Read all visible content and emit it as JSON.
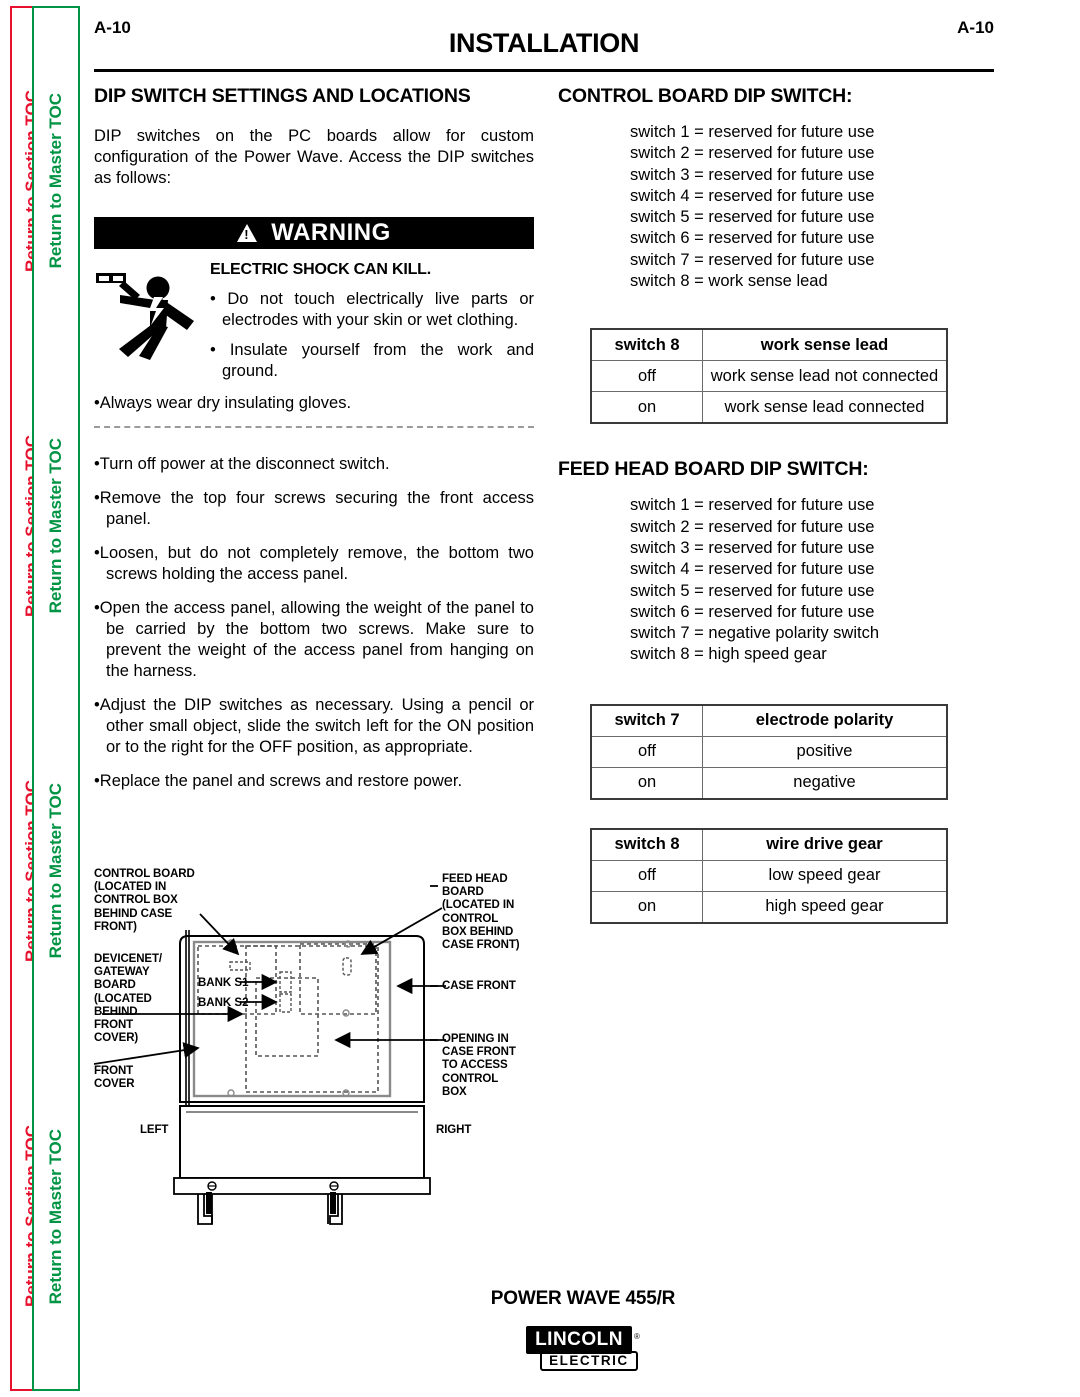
{
  "sidebar": {
    "section_toc_label": "Return to Section TOC",
    "master_toc_label": "Return to Master TOC",
    "section_color": "#e8112d",
    "master_color": "#009444",
    "repeat_count": 4
  },
  "header": {
    "page_number_left": "A-10",
    "page_number_right": "A-10",
    "title": "INSTALLATION"
  },
  "left_column": {
    "heading": "DIP SWITCH SETTINGS AND LOCATIONS",
    "intro": "DIP switches on the PC boards allow for custom configuration of the Power Wave.  Access the DIP switches as follows:",
    "warning": {
      "banner_label": "WARNING",
      "icon": "warning-triangle-icon",
      "pictogram": "electric-shock-figure-icon",
      "heading": "ELECTRIC SHOCK CAN KILL.",
      "bullets": [
        "Do not touch electrically live parts or electrodes with your skin or wet clothing.",
        "Insulate yourself from the work and ground."
      ],
      "full_width_bullet": "Always wear dry insulating gloves."
    },
    "steps": [
      "Turn off power at the disconnect switch.",
      "Remove the top four screws securing the front access panel.",
      "Loosen, but do not completely remove, the bottom two screws holding the access panel.",
      "Open the access panel, allowing the weight of the panel to be carried by the bottom two screws.  Make sure to prevent the weight of the access  panel from hanging on the harness.",
      "Adjust the DIP switches as necessary.  Using a pencil or other small object, slide the switch left for the ON position or to the right for the OFF position, as appropriate.",
      "Replace the panel and screws and restore power."
    ]
  },
  "right_column": {
    "control_board": {
      "heading": "CONTROL BOARD DIP SWITCH:",
      "switches": [
        "switch 1 = reserved for future use",
        "switch 2 = reserved for future use",
        "switch 3 = reserved for future use",
        "switch 4 = reserved for future use",
        "switch 5 = reserved for future use",
        "switch 6 = reserved for future use",
        "switch 7 = reserved for future use",
        "switch 8 = work sense lead"
      ],
      "table": {
        "headers": [
          "switch 8",
          "work sense lead"
        ],
        "rows": [
          [
            "off",
            "work sense lead not connected"
          ],
          [
            "on",
            "work sense lead connected"
          ]
        ]
      }
    },
    "feed_head_board": {
      "heading": "FEED HEAD BOARD DIP SWITCH:",
      "switches": [
        "switch 1 = reserved for future use",
        "switch 2 = reserved for future use",
        "switch 3 = reserved for future use",
        "switch 4 = reserved for future use",
        "switch 5 = reserved for future use",
        "switch 6 = reserved for future use",
        "switch 7 = negative polarity switch",
        "switch 8 = high speed gear"
      ],
      "table_polarity": {
        "headers": [
          "switch 7",
          "electrode polarity"
        ],
        "rows": [
          [
            "off",
            "positive"
          ],
          [
            "on",
            "negative"
          ]
        ]
      },
      "table_gear": {
        "headers": [
          "switch 8",
          "wire drive gear"
        ],
        "rows": [
          [
            "off",
            "low speed gear"
          ],
          [
            "on",
            "high speed gear"
          ]
        ]
      }
    }
  },
  "diagram": {
    "labels": {
      "control_board": "CONTROL BOARD\n(LOCATED IN\nCONTROL BOX\nBEHIND CASE\nFRONT)",
      "devicenet": "DEVICENET/\nGATEWAY\nBOARD\n(LOCATED\nBEHIND\nFRONT\nCOVER)",
      "front_cover": "FRONT\nCOVER",
      "feed_head": "FEED HEAD\nBOARD\n(LOCATED IN\nCONTROL\nBOX BEHIND\nCASE FRONT)",
      "case_front": "CASE FRONT",
      "opening": "OPENING IN\nCASE FRONT\nTO ACCESS\nCONTROL\nBOX",
      "left": "LEFT",
      "right": "RIGHT",
      "bank_s1": "BANK S1",
      "bank_s2": "BANK S2"
    }
  },
  "footer": {
    "model": "POWER WAVE 455/R",
    "logo_primary": "LINCOLN",
    "logo_registered": "®",
    "logo_secondary": "ELECTRIC"
  }
}
